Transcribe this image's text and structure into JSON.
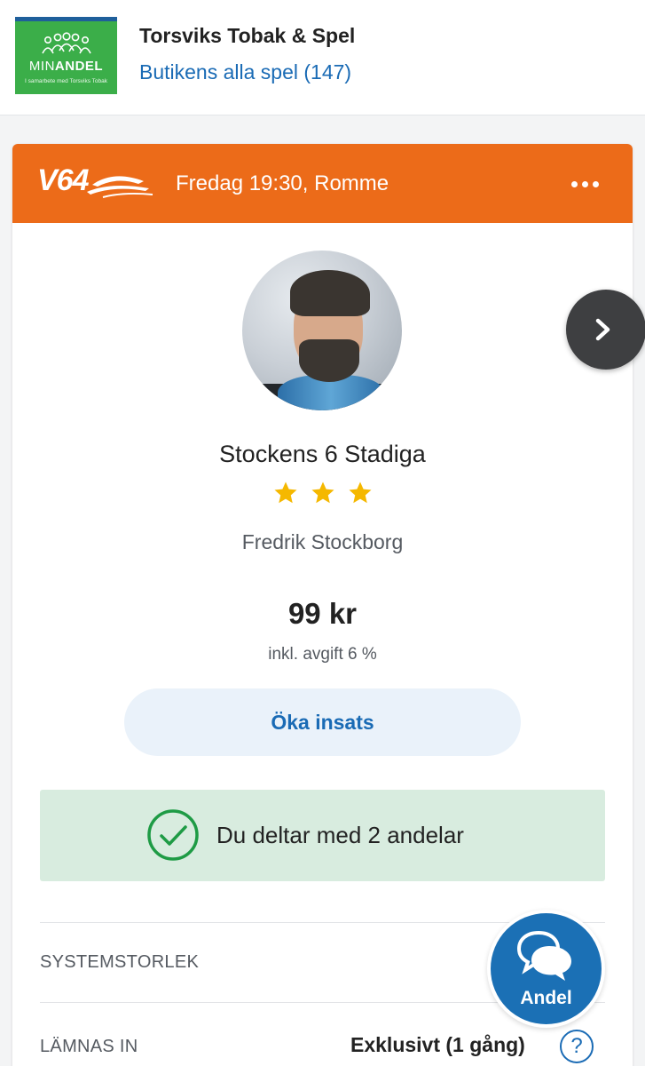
{
  "store": {
    "logo": {
      "prefix": "MIN",
      "brand": "ANDEL",
      "subtitle": "I samarbete med Torsviks Tobak"
    },
    "name": "Torsviks Tobak & Spel",
    "games_link": "Butikens alla spel (147)"
  },
  "card": {
    "game": "V64",
    "race_time": "Fredag 19:30, Romme",
    "syndicate_name": "Stockens 6 Stadiga",
    "rating_stars": 3,
    "owner": "Fredrik Stockborg",
    "price": "99 kr",
    "fee": "inkl. avgift 6 %",
    "raise_button": "Öka insats",
    "participation": "Du deltar med 2 andelar",
    "details": [
      {
        "label": "SYSTEMSTORLEK",
        "value": ""
      },
      {
        "label": "LÄMNAS IN",
        "value": "Exklusivt (1 gång)"
      }
    ]
  },
  "share_button": {
    "label": "Andel"
  },
  "colors": {
    "header_orange": "#ec6b19",
    "link_blue": "#1a6bb5",
    "success_green": "#1e9b45",
    "success_bg": "#d8ecdf",
    "star_gold": "#f5b800",
    "logo_green": "#3bae49"
  }
}
